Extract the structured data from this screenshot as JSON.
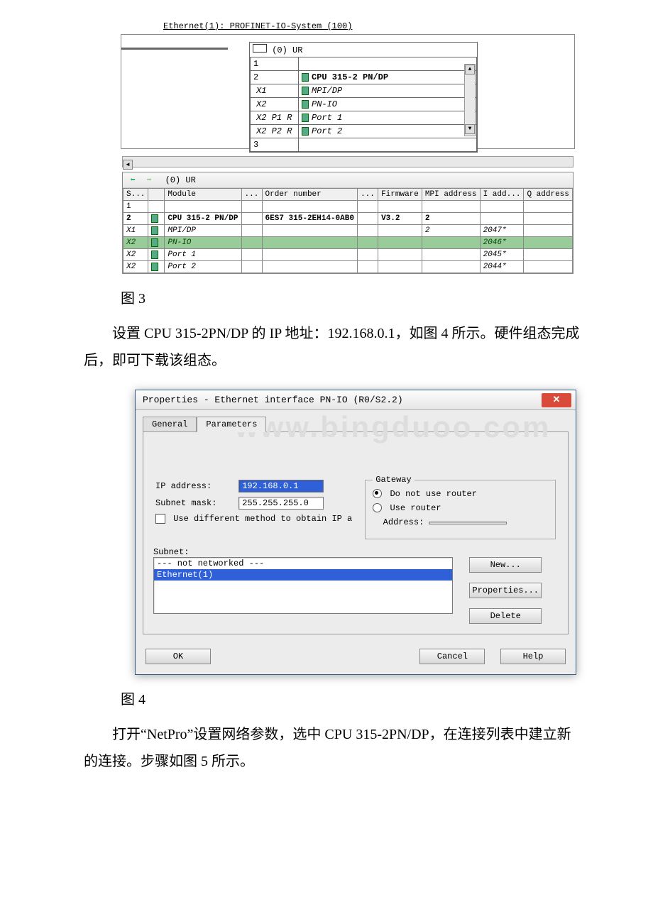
{
  "topology": {
    "subnet_label": "Ethernet(1): PROFINET-IO-System (100)",
    "rack_header": "(0) UR",
    "rows": [
      {
        "slot": "1",
        "name": ""
      },
      {
        "slot": "2",
        "name": "CPU 315-2 PN/DP"
      },
      {
        "slot": "X1",
        "name": "MPI/DP"
      },
      {
        "slot": "X2",
        "name": "PN-IO"
      },
      {
        "slot": "X2 P1 R",
        "name": "Port 1"
      },
      {
        "slot": "X2 P2 R",
        "name": "Port 2"
      },
      {
        "slot": "3",
        "name": ""
      }
    ]
  },
  "detail": {
    "header": "(0)    UR",
    "cols": [
      "S...",
      "Module",
      "...",
      "Order number",
      "...",
      "Firmware",
      "MPI address",
      "I add...",
      "Q address"
    ],
    "rows": [
      {
        "s": "1",
        "module": "",
        "order": "",
        "fw": "",
        "mpi": "",
        "iaddr": "",
        "qaddr": ""
      },
      {
        "s": "2",
        "module": "CPU 315-2 PN/DP",
        "order": "6ES7 315-2EH14-0AB0",
        "fw": "V3.2",
        "mpi": "2",
        "iaddr": "",
        "qaddr": ""
      },
      {
        "s": "X1",
        "module": "MPI/DP",
        "order": "",
        "fw": "",
        "mpi": "2",
        "iaddr": "2047*",
        "qaddr": ""
      },
      {
        "s": "X2",
        "module": "PN-IO",
        "order": "",
        "fw": "",
        "mpi": "",
        "iaddr": "2046*",
        "qaddr": "",
        "green": true
      },
      {
        "s": "X2",
        "module": "Port 1",
        "order": "",
        "fw": "",
        "mpi": "",
        "iaddr": "2045*",
        "qaddr": ""
      },
      {
        "s": "X2",
        "module": "Port 2",
        "order": "",
        "fw": "",
        "mpi": "",
        "iaddr": "2044*",
        "qaddr": ""
      }
    ]
  },
  "caption1": "图 3",
  "para1": "设置 CPU 315-2PN/DP 的 IP 地址：192.168.0.1，如图 4 所示。硬件组态完成后，即可下载该组态。",
  "dialog": {
    "title": "Properties - Ethernet interface  PN-IO (R0/S2.2)",
    "watermark": "www.bingduoo.com",
    "tabs": {
      "general": "General",
      "parameters": "Parameters"
    },
    "ip_label": "IP address:",
    "ip_value": "192.168.0.1",
    "mask_label": "Subnet mask:",
    "mask_value": "255.255.255.0",
    "diff_method": "Use different method to obtain IP a",
    "gateway_legend": "Gateway",
    "gw_no_router": "Do not use router",
    "gw_use_router": "Use router",
    "gw_addr_label": "Address:",
    "subnet_label": "Subnet:",
    "subnet_none": "--- not networked ---",
    "subnet_selected": "Ethernet(1)",
    "btn_new": "New...",
    "btn_prop": "Properties...",
    "btn_del": "Delete",
    "btn_ok": "OK",
    "btn_cancel": "Cancel",
    "btn_help": "Help"
  },
  "caption2": "图 4",
  "para2": "打开“NetPro”设置网络参数，选中 CPU 315-2PN/DP，在连接列表中建立新的连接。步骤如图 5 所示。"
}
